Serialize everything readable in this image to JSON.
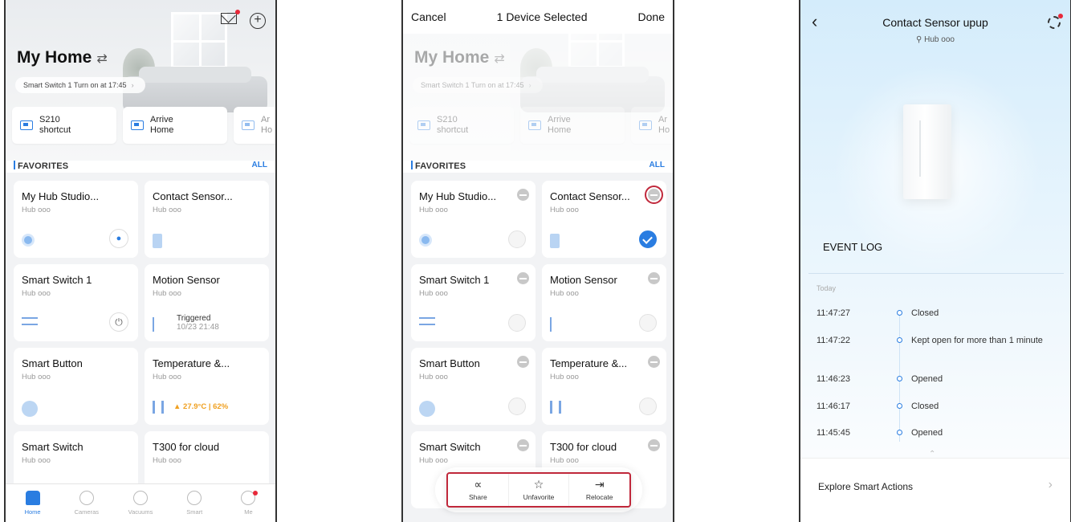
{
  "home": {
    "title": "My Home",
    "swap_icon": "⇄",
    "notice": "Smart Switch 1 Turn on at 17:45",
    "shortcuts": [
      {
        "label": "S210\nshortcut"
      },
      {
        "label": "Arrive\nHome"
      },
      {
        "label": "Ar\nHo"
      }
    ],
    "favorites_label": "FAVORITES",
    "all_label": "ALL",
    "devices": [
      {
        "name": "My Hub Studio...",
        "sub": "Hub ooo",
        "icon": "hub-icon"
      },
      {
        "name": "Contact Sensor...",
        "sub": "Hub ooo",
        "icon": "contact-sensor-icon"
      },
      {
        "name": "Smart Switch 1",
        "sub": "Hub ooo",
        "icon": "switch-icon"
      },
      {
        "name": "Motion Sensor",
        "sub": "Hub ooo",
        "icon": "motion-sensor-icon",
        "status": "Triggered",
        "status_time": "10/23 21:48"
      },
      {
        "name": "Smart Button",
        "sub": "Hub ooo",
        "icon": "button-icon"
      },
      {
        "name": "Temperature &...",
        "sub": "Hub ooo",
        "icon": "thermometer-icon",
        "reading": "▲ 27.9°C | 62%"
      },
      {
        "name": "Smart Switch",
        "sub": "Hub ooo",
        "icon": "switch-icon"
      },
      {
        "name": "T300 for cloud",
        "sub": "Hub ooo",
        "icon": "water-sensor-icon"
      }
    ],
    "tabs": [
      {
        "label": "Home",
        "icon": "home-icon"
      },
      {
        "label": "Cameras",
        "icon": "camera-icon"
      },
      {
        "label": "Vacuums",
        "icon": "vacuum-icon"
      },
      {
        "label": "Smart",
        "icon": "smart-icon"
      },
      {
        "label": "Me",
        "icon": "profile-icon"
      }
    ],
    "power_glyph": "⏻",
    "bell_glyph": "🔔"
  },
  "selection": {
    "cancel": "Cancel",
    "title": "1 Device Selected",
    "done": "Done",
    "actions": [
      {
        "label": "Share",
        "glyph": "⟨⟩",
        "icon": "share-icon"
      },
      {
        "label": "Unfavorite",
        "glyph": "☆",
        "icon": "unfavorite-icon"
      },
      {
        "label": "Relocate",
        "glyph": "⇥",
        "icon": "relocate-icon"
      }
    ]
  },
  "detail": {
    "back": "‹",
    "title": "Contact Sensor upup",
    "location": "⚲ Hub ooo",
    "event_log_title": "EVENT LOG",
    "today_label": "Today",
    "events": [
      {
        "time": "11:47:27",
        "text": "Closed"
      },
      {
        "time": "11:47:22",
        "text": "Kept open for more than 1 minute"
      },
      {
        "time": "11:46:23",
        "text": "Opened"
      },
      {
        "time": "11:46:17",
        "text": "Closed"
      },
      {
        "time": "11:45:45",
        "text": "Opened"
      }
    ],
    "explore_label": "Explore Smart Actions",
    "explore_chev": "›",
    "up_chev": "⌃"
  },
  "colors": {
    "accent": "#2a7de1",
    "highlight_box": "#c0283b",
    "warning": "#f0a020",
    "notification_dot": "#e8293a"
  }
}
